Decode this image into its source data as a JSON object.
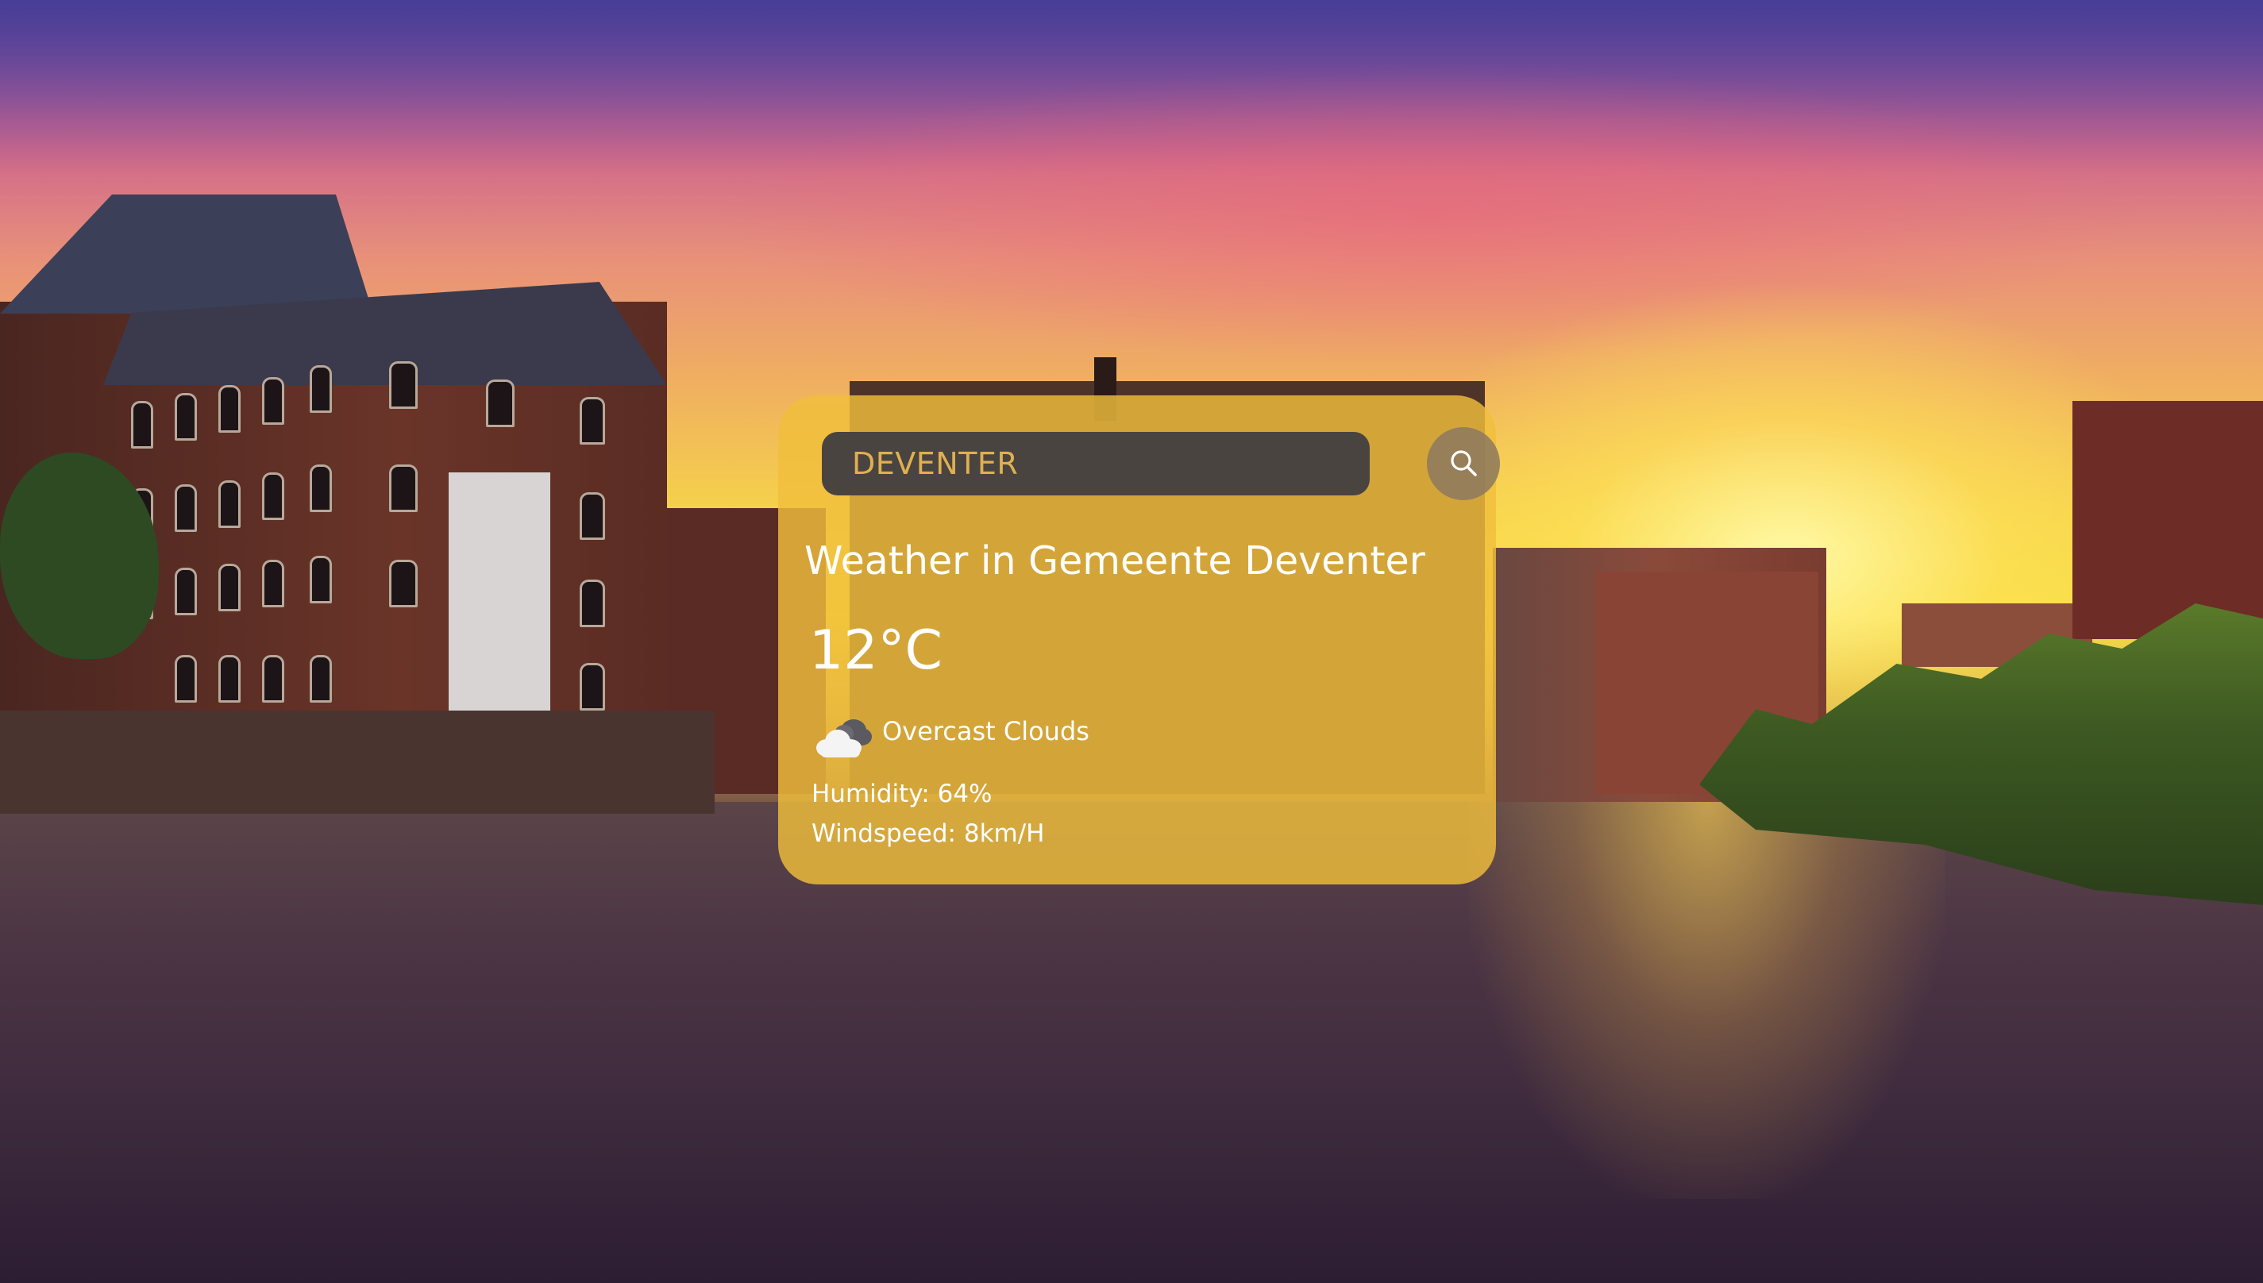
{
  "search": {
    "value": "DEVENTER",
    "button_icon": "search-icon"
  },
  "weather": {
    "title": "Weather in Gemeente Deventer",
    "temperature": "12°C",
    "description": "Overcast Clouds",
    "description_icon": "overcast-clouds-icon",
    "humidity": "Humidity: 64%",
    "windspeed": "Windspeed: 8km/H"
  },
  "colors": {
    "card": "#f0be3c",
    "search_field": "#4a4440",
    "search_text": "#e0b050",
    "text": "#ffffff"
  }
}
